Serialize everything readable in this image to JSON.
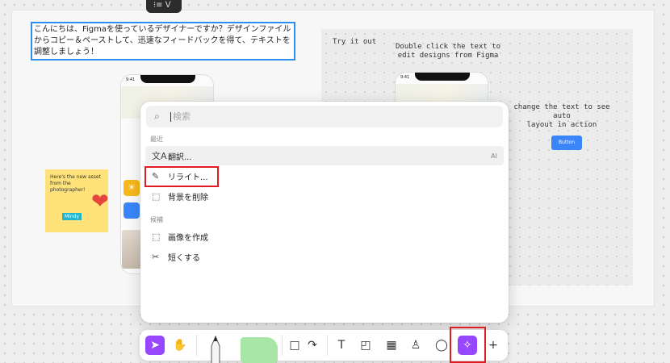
{
  "top_pill_label": "⁝≡ ᐯ",
  "canvas": {
    "jp_text": "こんにちは、Figmaを使っているデザイナーですか？デザインファイルからコピー＆ペーストして、迅速なフィードバックを得て、テキストを調整しましょう！",
    "try_it_out": "Try it out",
    "double_click": "Double click the text to\nedit designs from Figma",
    "change_text": "change the text to see auto\nlayout in action",
    "button_label": "Button",
    "phone_time": "9:41",
    "sticky_text": "Here's the new asset from the photographer!",
    "mindy_label": "Mindy"
  },
  "menu": {
    "search_placeholder": "検索",
    "section_recent": "最近",
    "section_suggested": "候補",
    "items": [
      {
        "label": "翻訳...",
        "icon": "translate-icon",
        "tag": "AI"
      },
      {
        "label": "リライト...",
        "icon": "rewrite-icon"
      },
      {
        "label": "背景を削除",
        "icon": "remove-background-icon"
      },
      {
        "label": "画像を作成",
        "icon": "make-image-icon"
      },
      {
        "label": "短くする",
        "icon": "shorten-icon"
      }
    ]
  },
  "toolbar": {
    "tools": [
      "move-tool",
      "hand-tool",
      "pencil-tool",
      "sticky-tool",
      "shape-tool",
      "text-tool",
      "section-tool",
      "table-tool",
      "stamp-tool",
      "comment-tool",
      "actions-tool",
      "more-tool"
    ],
    "accent": "#9747ff"
  },
  "colors": {
    "highlight": "#e11b22",
    "selection_blue": "#2b8ff0"
  }
}
